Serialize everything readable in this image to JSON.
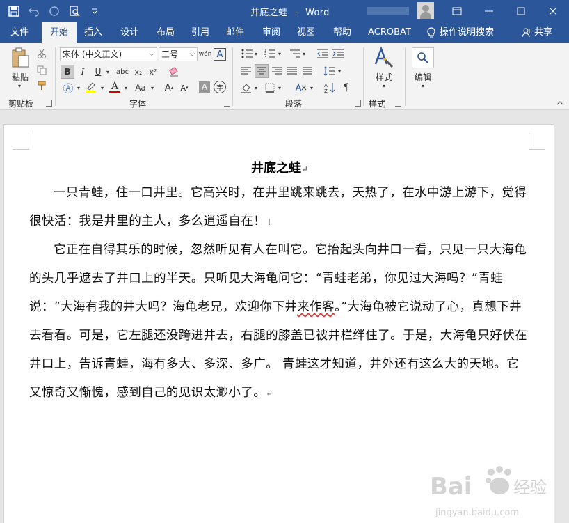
{
  "window": {
    "doc_title": "井底之蛙",
    "app_name": "Word",
    "title_separator": "-"
  },
  "tabs": [
    {
      "label": "文件"
    },
    {
      "label": "开始"
    },
    {
      "label": "插入"
    },
    {
      "label": "设计"
    },
    {
      "label": "布局"
    },
    {
      "label": "引用"
    },
    {
      "label": "邮件"
    },
    {
      "label": "审阅"
    },
    {
      "label": "视图"
    },
    {
      "label": "帮助"
    },
    {
      "label": "ACROBAT"
    },
    {
      "label": "操作说明搜索"
    },
    {
      "label": "共享"
    }
  ],
  "ribbon": {
    "clipboard": {
      "paste_label": "粘贴",
      "group_label": "剪贴板"
    },
    "font": {
      "font_name": "宋体 (中文正文)",
      "font_size": "三号",
      "group_label": "字体",
      "bold": "B",
      "italic": "I",
      "underline": "U",
      "strike": "abc",
      "subscript": "x₂",
      "superscript": "x²",
      "font_color_letter": "A",
      "change_case": "Aa",
      "grow": "A",
      "shrink": "A",
      "char_shade": "A",
      "phonetic": "wén",
      "enclose": "字"
    },
    "paragraph": {
      "group_label": "段落"
    },
    "styles": {
      "label": "样式",
      "group_label": "样式"
    },
    "editing": {
      "label": "编辑"
    }
  },
  "document": {
    "heading": "井底之蛙",
    "paragraph1": "一只青蛙，住一口井里。它高兴时，在井里跳来跳去，天热了，在水中游上游下，觉得很快活：我是井里的主人，多么逍遥自在！",
    "paragraph2_a": "它正在自得其乐的时候，忽然听见有人在叫它。它抬起头向井口一看，只见一只大海龟的头几乎遮去了井口上的半天。只听见大海龟问它：“青蛙老弟，你见过大海吗？”青蛙说：“大海有我的井大吗？海龟老兄，欢迎你下井",
    "paragraph2_squiggle": "来作客",
    "paragraph2_b": "。”大海龟被它说动了心，真想下井去看看。可是，它左腿还没跨进井去，右腿的膝盖已被井栏绊住了。于是，大海龟只好伏在井口上，告诉青蛙，海有多大、多深、多广。  青蛙这才知道，井外还有这么大的天地。它又惊奇又惭愧，感到自己的见识太渺小了。",
    "para_mark": "↵",
    "line_break_mark": "↓"
  },
  "watermark": {
    "brand": "Bai",
    "brand2": "经验",
    "url": "jingyan.baidu.com"
  },
  "colors": {
    "title_bar": "#2b579a",
    "ribbon": "#f3f3f3",
    "highlight": "#ffff00",
    "font_red": "#e00000"
  }
}
